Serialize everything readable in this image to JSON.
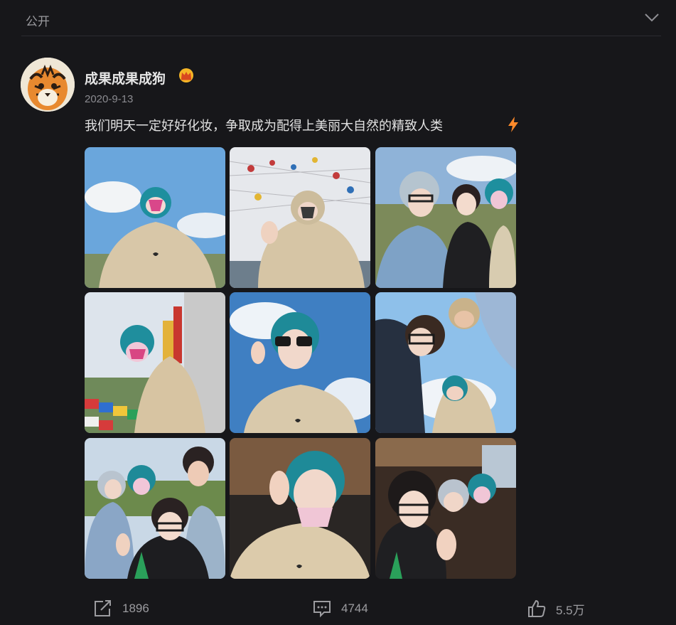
{
  "topbar": {
    "visibility_label": "公开",
    "collapse_icon": "chevron-down-icon"
  },
  "post": {
    "author": {
      "name": "成果成果成狗",
      "badge_icon": "crown-icon",
      "avatar_icon": "tiger-avatar"
    },
    "date": "2020-9-13",
    "text": "我们明天一定好好化妆，争取成为配得上美丽大自然的精致人类",
    "trailing_icon": "lightning-icon",
    "photos": [
      {
        "id": "photo-1",
        "desc": "teal hair, mask, beige hoodie, blue sky"
      },
      {
        "id": "photo-2",
        "desc": "hooded pose under hanging prayer flags"
      },
      {
        "id": "photo-3",
        "desc": "three friends selfie on grassland"
      },
      {
        "id": "photo-4",
        "desc": "walking by colorful prayer flags"
      },
      {
        "id": "photo-5",
        "desc": "sunglasses selfie, peace sign, sky"
      },
      {
        "id": "photo-6",
        "desc": "group selfie from below"
      },
      {
        "id": "photo-7",
        "desc": "four friends, thumbs up"
      },
      {
        "id": "photo-8",
        "desc": "peace sign close-up with mask"
      },
      {
        "id": "photo-9",
        "desc": "car interior selfie"
      }
    ]
  },
  "actions": {
    "share": {
      "icon": "share-icon",
      "count": "1896"
    },
    "comment": {
      "icon": "comment-icon",
      "count": "4744"
    },
    "like": {
      "icon": "thumbs-up-icon",
      "count": "5.5万"
    }
  },
  "colors": {
    "background": "#17171a",
    "muted": "#9a9a9e",
    "text": "#e2e2e2",
    "accent_orange": "#ff8a2a",
    "crown_gold": "#f5b526"
  }
}
